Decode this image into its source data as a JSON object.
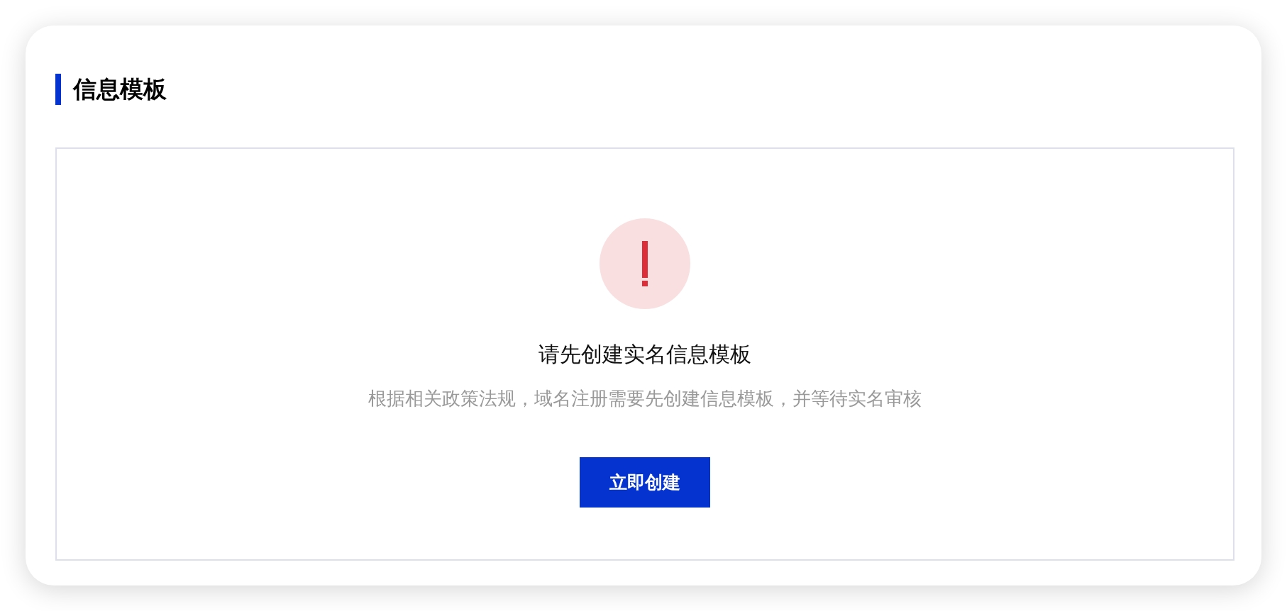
{
  "section": {
    "title": "信息模板"
  },
  "empty_state": {
    "heading": "请先创建实名信息模板",
    "description": "根据相关政策法规，域名注册需要先创建信息模板，并等待实名审核",
    "button": "立即创建"
  }
}
